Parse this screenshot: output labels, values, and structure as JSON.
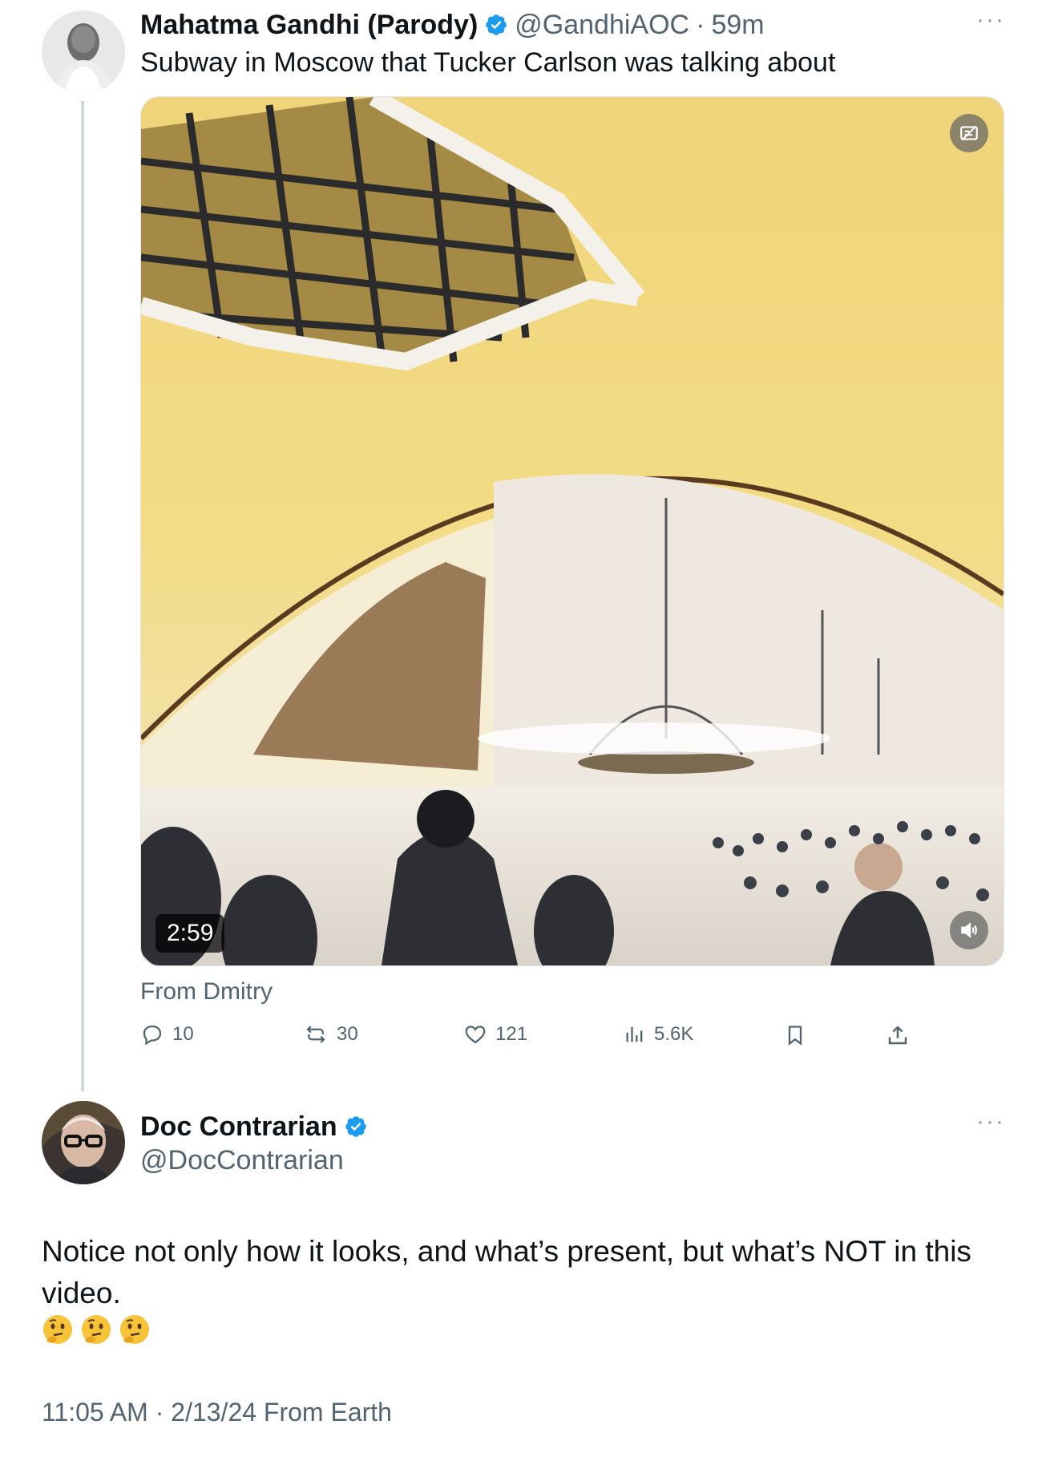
{
  "tweet1": {
    "author_name": "Mahatma Gandhi (Parody)",
    "handle": "@GandhiAOC",
    "separator": "·",
    "time": "59m",
    "more": "···",
    "text": "Subway in Moscow that Tucker Carlson was talking about",
    "video": {
      "duration": "2:59",
      "top_icon": "alt-text-icon",
      "bottom_icon": "volume-icon"
    },
    "from": "From Dmitry",
    "actions": {
      "replies": "10",
      "reposts": "30",
      "likes": "121",
      "views": "5.6K"
    }
  },
  "tweet2": {
    "author_name": "Doc Contrarian",
    "handle": "@DocContrarian",
    "more": "···",
    "text": "Notice not only how it looks, and what’s present, but what’s NOT in this video.",
    "emojis": [
      "thinking-face",
      "thinking-face",
      "thinking-face"
    ],
    "timestamp": "11:05 AM · 2/13/24 From Earth"
  },
  "colors": {
    "verified": "#1d9bf0",
    "secondary_text": "#536471",
    "thread_line": "#cfd9de"
  }
}
